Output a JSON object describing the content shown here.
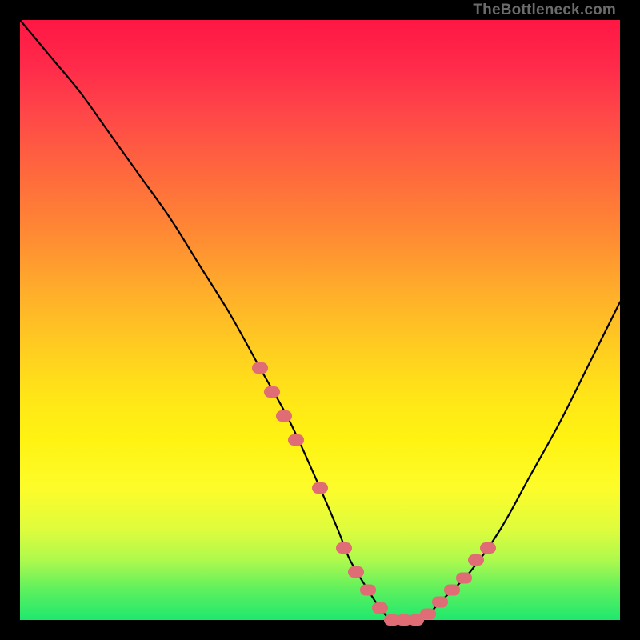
{
  "watermark": "TheBottleneck.com",
  "colors": {
    "background": "#000000",
    "gradient_top": "#ff1744",
    "gradient_mid": "#ffe617",
    "gradient_bot": "#1fe86e",
    "curve": "#000000",
    "marker": "#e06c75"
  },
  "chart_data": {
    "type": "line",
    "title": "",
    "xlabel": "",
    "ylabel": "",
    "xlim": [
      0,
      100
    ],
    "ylim": [
      0,
      100
    ],
    "series": [
      {
        "name": "bottleneck-curve",
        "x": [
          0,
          5,
          10,
          15,
          20,
          25,
          30,
          35,
          40,
          45,
          50,
          53,
          55,
          58,
          60,
          62,
          65,
          68,
          70,
          75,
          80,
          85,
          90,
          95,
          100
        ],
        "values": [
          100,
          94,
          88,
          81,
          74,
          67,
          59,
          51,
          42,
          33,
          22,
          15,
          10,
          5,
          2,
          0,
          0,
          1,
          3,
          8,
          15,
          24,
          33,
          43,
          53
        ]
      }
    ],
    "markers": {
      "name": "highlight-points",
      "x": [
        40,
        42,
        44,
        46,
        50,
        54,
        56,
        58,
        60,
        62,
        64,
        66,
        68,
        70,
        72,
        74,
        76,
        78
      ],
      "values": [
        42,
        38,
        34,
        30,
        22,
        12,
        8,
        5,
        2,
        0,
        0,
        0,
        1,
        3,
        5,
        7,
        10,
        12
      ]
    }
  }
}
